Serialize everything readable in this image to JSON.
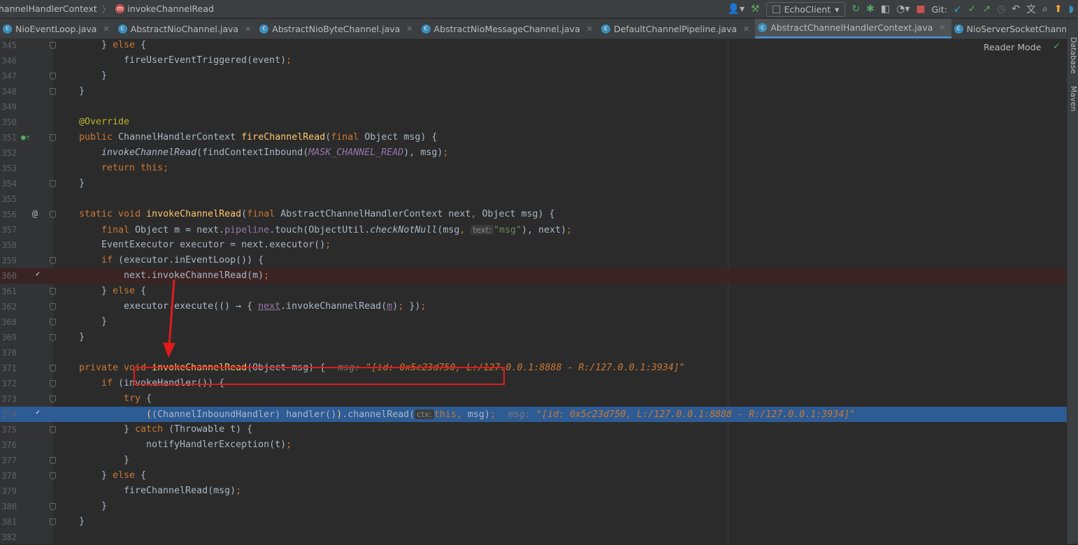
{
  "breadcrumb": {
    "items": [
      "hannelHandlerContext",
      "invokeChannelRead"
    ],
    "method_icon": "m"
  },
  "toolbar": {
    "run_config": "EchoClient",
    "git_label": "Git:",
    "icons": [
      "user-icon",
      "hammer-icon",
      "rerun-icon",
      "debug-icon",
      "coverage-icon",
      "profile-icon",
      "stop-icon",
      "git-update-icon",
      "git-commit-icon",
      "git-push-icon",
      "history-icon",
      "rollback-icon",
      "translate-icon",
      "search-icon",
      "update-icon",
      "plugin-icon"
    ]
  },
  "tabs": [
    {
      "label": "NioEventLoop.java",
      "active": false
    },
    {
      "label": "AbstractNioChannel.java",
      "active": false
    },
    {
      "label": "AbstractNioByteChannel.java",
      "active": false
    },
    {
      "label": "AbstractNioMessageChannel.java",
      "active": false
    },
    {
      "label": "DefaultChannelPipeline.java",
      "active": false
    },
    {
      "label": "AbstractChannelHandlerContext.java",
      "active": true
    },
    {
      "label": "NioServerSocketChannel.java",
      "active": false
    }
  ],
  "editor": {
    "reader_mode": "Reader Mode",
    "colors": {
      "background": "#2B2B2B",
      "keyword": "#CC7832",
      "method": "#FFC66D",
      "breakpoint_line": "#3A2323",
      "execution_line": "#2D5B94"
    },
    "lines": [
      {
        "n": "345",
        "i": 1,
        "fold": true,
        "t": [
          [
            "",
            "} "
          ],
          [
            "kw",
            "else"
          ],
          [
            "",
            " {"
          ]
        ]
      },
      {
        "n": "346",
        "i": 2,
        "t": [
          [
            "",
            "fireUserEventTriggered(event)"
          ],
          [
            "kw",
            ";"
          ]
        ]
      },
      {
        "n": "347",
        "i": 1,
        "fold": true,
        "t": [
          [
            "",
            "}"
          ]
        ]
      },
      {
        "n": "348",
        "i": 0,
        "fold": true,
        "t": [
          [
            "",
            "}"
          ]
        ]
      },
      {
        "n": "349",
        "i": 0,
        "t": []
      },
      {
        "n": "350",
        "i": 0,
        "t": [
          [
            "an",
            "@Override"
          ]
        ]
      },
      {
        "n": "351",
        "i": 0,
        "gutter": "override",
        "fold": true,
        "t": [
          [
            "kw",
            "public "
          ],
          [
            "",
            "ChannelHandlerContext "
          ],
          [
            "fn",
            "fireChannelRead"
          ],
          [
            "",
            "("
          ],
          [
            "kw",
            "final "
          ],
          [
            "",
            "Object msg) {"
          ]
        ]
      },
      {
        "n": "352",
        "i": 1,
        "t": [
          [
            "st",
            "invokeChannelRead"
          ],
          [
            "",
            "(findContextInbound("
          ],
          [
            "fdi",
            "MASK_CHANNEL_READ"
          ],
          [
            "",
            "), msg)"
          ],
          [
            "kw",
            ";"
          ]
        ]
      },
      {
        "n": "353",
        "i": 1,
        "t": [
          [
            "kw",
            "return this;"
          ]
        ]
      },
      {
        "n": "354",
        "i": 0,
        "fold": true,
        "t": [
          [
            "",
            "}"
          ]
        ]
      },
      {
        "n": "355",
        "i": 0,
        "t": []
      },
      {
        "n": "356",
        "i": 0,
        "gutter": "at",
        "fold": true,
        "t": [
          [
            "kw",
            "static void "
          ],
          [
            "fn",
            "invokeChannelRead"
          ],
          [
            "",
            "("
          ],
          [
            "kw",
            "final "
          ],
          [
            "",
            "AbstractChannelHandlerContext next"
          ],
          [
            "kw",
            ", "
          ],
          [
            "",
            "Object msg) {"
          ]
        ]
      },
      {
        "n": "357",
        "i": 1,
        "t": [
          [
            "kw",
            "final "
          ],
          [
            "",
            "Object m = next."
          ],
          [
            "fd",
            "pipeline"
          ],
          [
            "",
            ".touch(ObjectUtil."
          ],
          [
            "st",
            "checkNotNull"
          ],
          [
            "",
            "(msg"
          ],
          [
            "kw",
            ", "
          ],
          [
            "hint",
            "text:"
          ],
          [
            "str",
            "\"msg\""
          ],
          [
            "",
            "), next)"
          ],
          [
            "kw",
            ";"
          ]
        ]
      },
      {
        "n": "358",
        "i": 1,
        "t": [
          [
            "",
            "EventExecutor executor = next.executor()"
          ],
          [
            "kw",
            ";"
          ]
        ]
      },
      {
        "n": "359",
        "i": 1,
        "fold": true,
        "t": [
          [
            "kw",
            "if "
          ],
          [
            "",
            "(executor.inEventLoop()) {"
          ]
        ]
      },
      {
        "n": "360",
        "i": 2,
        "gutter": "breakpoint",
        "bg": "breakpoint",
        "t": [
          [
            "",
            "next.invokeChannelRead(m)"
          ],
          [
            "kw",
            ";"
          ]
        ]
      },
      {
        "n": "361",
        "i": 1,
        "fold": true,
        "t": [
          [
            "",
            "} "
          ],
          [
            "kw",
            "else"
          ],
          [
            "",
            " {"
          ]
        ]
      },
      {
        "n": "362",
        "i": 2,
        "fold": true,
        "t": [
          [
            "",
            "executor.execute(() → { "
          ],
          [
            "ul fd",
            "next"
          ],
          [
            "",
            ".invokeChannelRead("
          ],
          [
            "ul fd",
            "m"
          ],
          [
            "",
            ")"
          ],
          [
            "kw",
            "; "
          ],
          [
            "",
            "})"
          ],
          [
            "kw",
            ";"
          ]
        ]
      },
      {
        "n": "368",
        "i": 1,
        "fold": true,
        "t": [
          [
            "",
            "}"
          ]
        ]
      },
      {
        "n": "369",
        "i": 0,
        "fold": true,
        "t": [
          [
            "",
            "}"
          ]
        ]
      },
      {
        "n": "370",
        "i": 0,
        "t": []
      },
      {
        "n": "371",
        "i": 0,
        "fold": true,
        "t": [
          [
            "kw",
            "private void "
          ],
          [
            "fn",
            "invokeChannelRead"
          ],
          [
            "",
            "(Object msg) {"
          ]
        ],
        "inline": {
          "name": "msg:",
          "value": "\"[id: 0x5c23d750, L:/127.0.0.1:8888 - R:/127.0.0.1:3934]\""
        }
      },
      {
        "n": "372",
        "i": 1,
        "fold": true,
        "t": [
          [
            "kw",
            "if "
          ],
          [
            "",
            "(invokeHandler()) {"
          ]
        ]
      },
      {
        "n": "373",
        "i": 2,
        "fold": true,
        "t": [
          [
            "kw",
            "try "
          ],
          [
            "",
            "{"
          ]
        ]
      },
      {
        "n": "374",
        "i": 3,
        "gutter": "breakpoint",
        "bg": "exec",
        "t": [
          [
            "fn",
            "("
          ],
          [
            "",
            "(ChannelInboundHandler) handler()"
          ],
          [
            "fn",
            ")"
          ],
          [
            "",
            ".channelRead("
          ],
          [
            "hint",
            "ctx:"
          ],
          [
            "kw",
            "this, "
          ],
          [
            "",
            "msg)"
          ],
          [
            "kw",
            ";"
          ]
        ],
        "inline": {
          "name": "msg:",
          "value": "\"[id: 0x5c23d750, L:/127.0.0.1:8888 - R:/127.0.0.1:3934]\""
        }
      },
      {
        "n": "375",
        "i": 2,
        "fold": true,
        "t": [
          [
            "",
            "} "
          ],
          [
            "kw",
            "catch "
          ],
          [
            "",
            "(Throwable t) {"
          ]
        ]
      },
      {
        "n": "376",
        "i": 3,
        "t": [
          [
            "",
            "notifyHandlerException(t)"
          ],
          [
            "kw",
            ";"
          ]
        ]
      },
      {
        "n": "377",
        "i": 2,
        "fold": true,
        "t": [
          [
            "",
            "}"
          ]
        ]
      },
      {
        "n": "378",
        "i": 1,
        "fold": true,
        "t": [
          [
            "",
            "} "
          ],
          [
            "kw",
            "else"
          ],
          [
            "",
            " {"
          ]
        ]
      },
      {
        "n": "379",
        "i": 2,
        "t": [
          [
            "",
            "fireChannelRead(msg)"
          ],
          [
            "kw",
            ";"
          ]
        ]
      },
      {
        "n": "380",
        "i": 1,
        "fold": true,
        "t": [
          [
            "",
            "}"
          ]
        ]
      },
      {
        "n": "381",
        "i": 0,
        "fold": true,
        "t": [
          [
            "",
            "}"
          ]
        ]
      },
      {
        "n": "382",
        "i": 0,
        "t": []
      }
    ]
  },
  "right_sidebar": {
    "items": [
      "Database",
      "Maven"
    ]
  }
}
